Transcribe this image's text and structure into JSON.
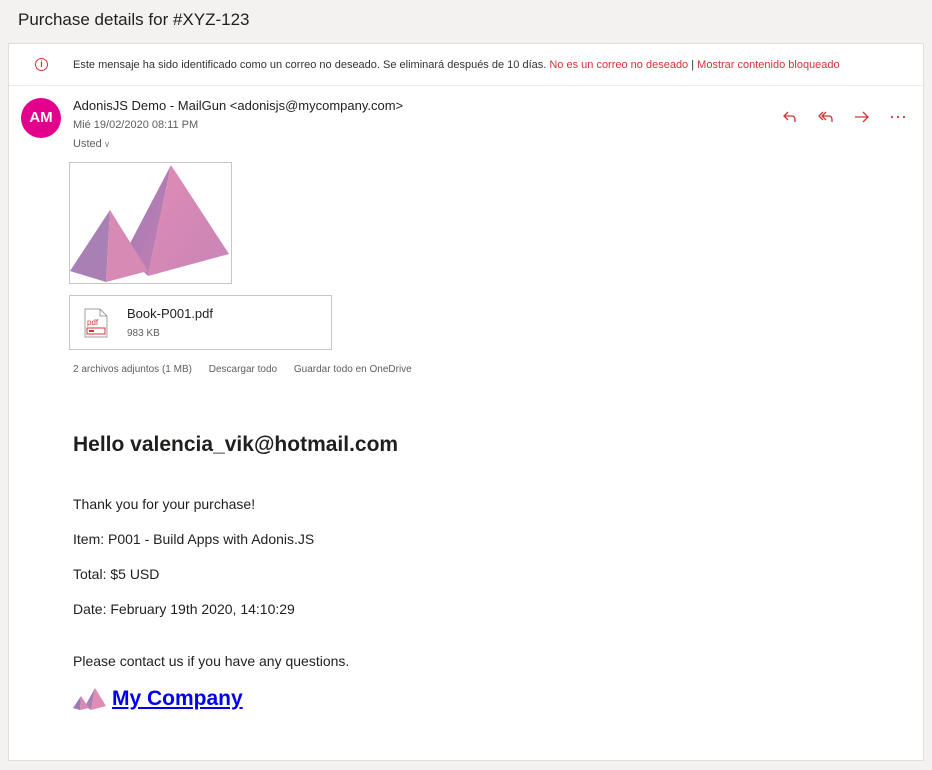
{
  "window": {
    "title": "Purchase details for #XYZ-123"
  },
  "junk_banner": {
    "icon": "info-icon",
    "message": "Este mensaje ha sido identificado como un correo no deseado. Se eliminará después de 10 días.",
    "not_junk_link": "No es un correo no deseado",
    "separator": "|",
    "show_blocked_link": "Mostrar contenido bloqueado"
  },
  "header": {
    "avatar_initials": "AM",
    "avatar_color": "#e3008c",
    "sender": "AdonisJS Demo - MailGun <adonisjs@mycompany.com>",
    "date": "Mié 19/02/2020 08:11 PM",
    "to": "Usted",
    "actions": [
      "reply-icon",
      "reply-all-icon",
      "forward-icon",
      "more-icon"
    ],
    "action_color": "#d13438"
  },
  "attachments": {
    "file_name": "Book-P001.pdf",
    "file_size": "983 KB",
    "summary": "2 archivos adjuntos (1 MB)",
    "download_all": "Descargar todo",
    "save_onedrive": "Guardar todo en OneDrive"
  },
  "body": {
    "greeting": "Hello valencia_vik@hotmail.com",
    "thanks": "Thank you for your purchase!",
    "item": "Item: P001 - Build Apps with Adonis.JS",
    "total": "Total: $5 USD",
    "date": "Date: February 19th 2020, 14:10:29",
    "contact": "Please contact us if you have any questions.",
    "company_link": "My Company"
  }
}
